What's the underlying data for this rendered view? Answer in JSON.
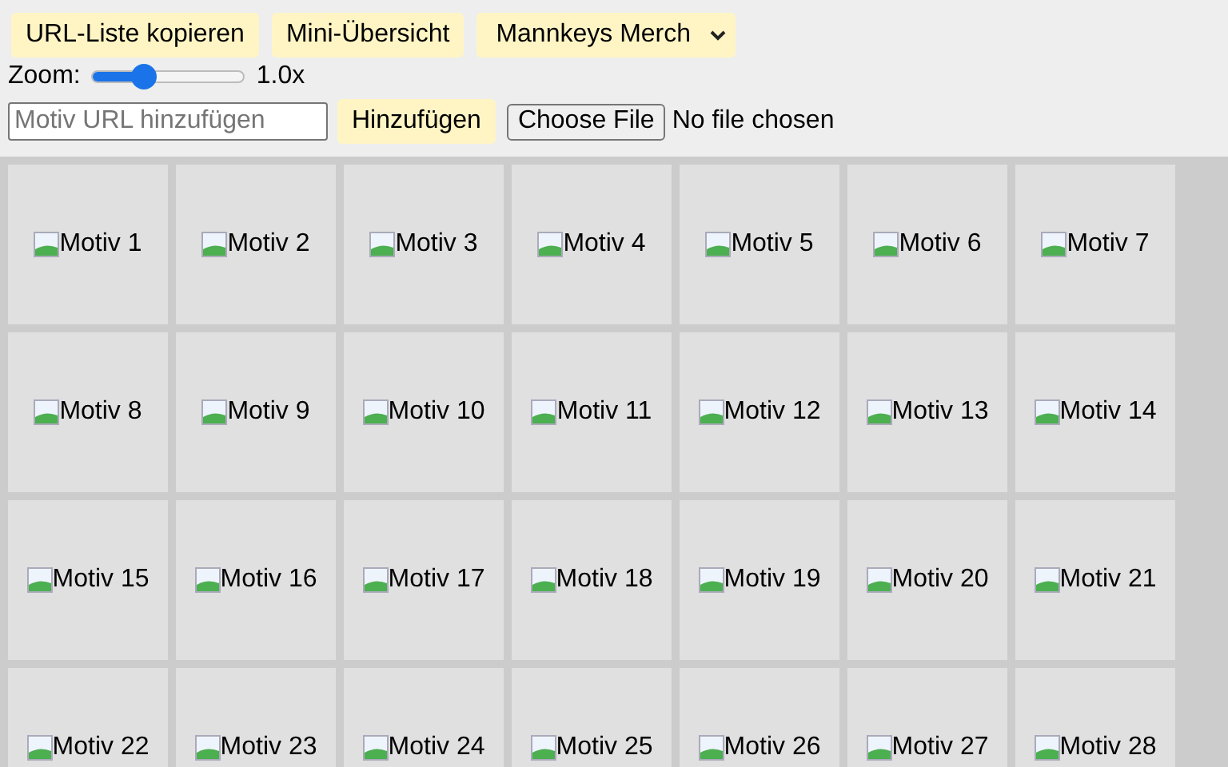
{
  "toolbar": {
    "buttons": [
      "URL-Liste kopieren",
      "Mini-Übersicht"
    ],
    "collection_select": {
      "value": "Mannkeys Merch"
    }
  },
  "zoom": {
    "label": "Zoom:",
    "level": 0.34,
    "reading": "1.0x"
  },
  "add_motif": {
    "placeholder": "Motiv URL hinzufügen",
    "button": "Hinzufügen"
  },
  "file_picker": {
    "button": "Choose File",
    "status": "No file chosen"
  },
  "tiles": [
    "Motiv 1",
    "Motiv 2",
    "Motiv 3",
    "Motiv 4",
    "Motiv 5",
    "Motiv 6",
    "Motiv 7",
    "Motiv 8",
    "Motiv 9",
    "Motiv 10",
    "Motiv 11",
    "Motiv 12",
    "Motiv 13",
    "Motiv 14",
    "Motiv 15",
    "Motiv 16",
    "Motiv 17",
    "Motiv 18",
    "Motiv 19",
    "Motiv 20",
    "Motiv 21",
    "Motiv 22",
    "Motiv 23",
    "Motiv 24",
    "Motiv 25",
    "Motiv 26",
    "Motiv 27",
    "Motiv 28"
  ]
}
